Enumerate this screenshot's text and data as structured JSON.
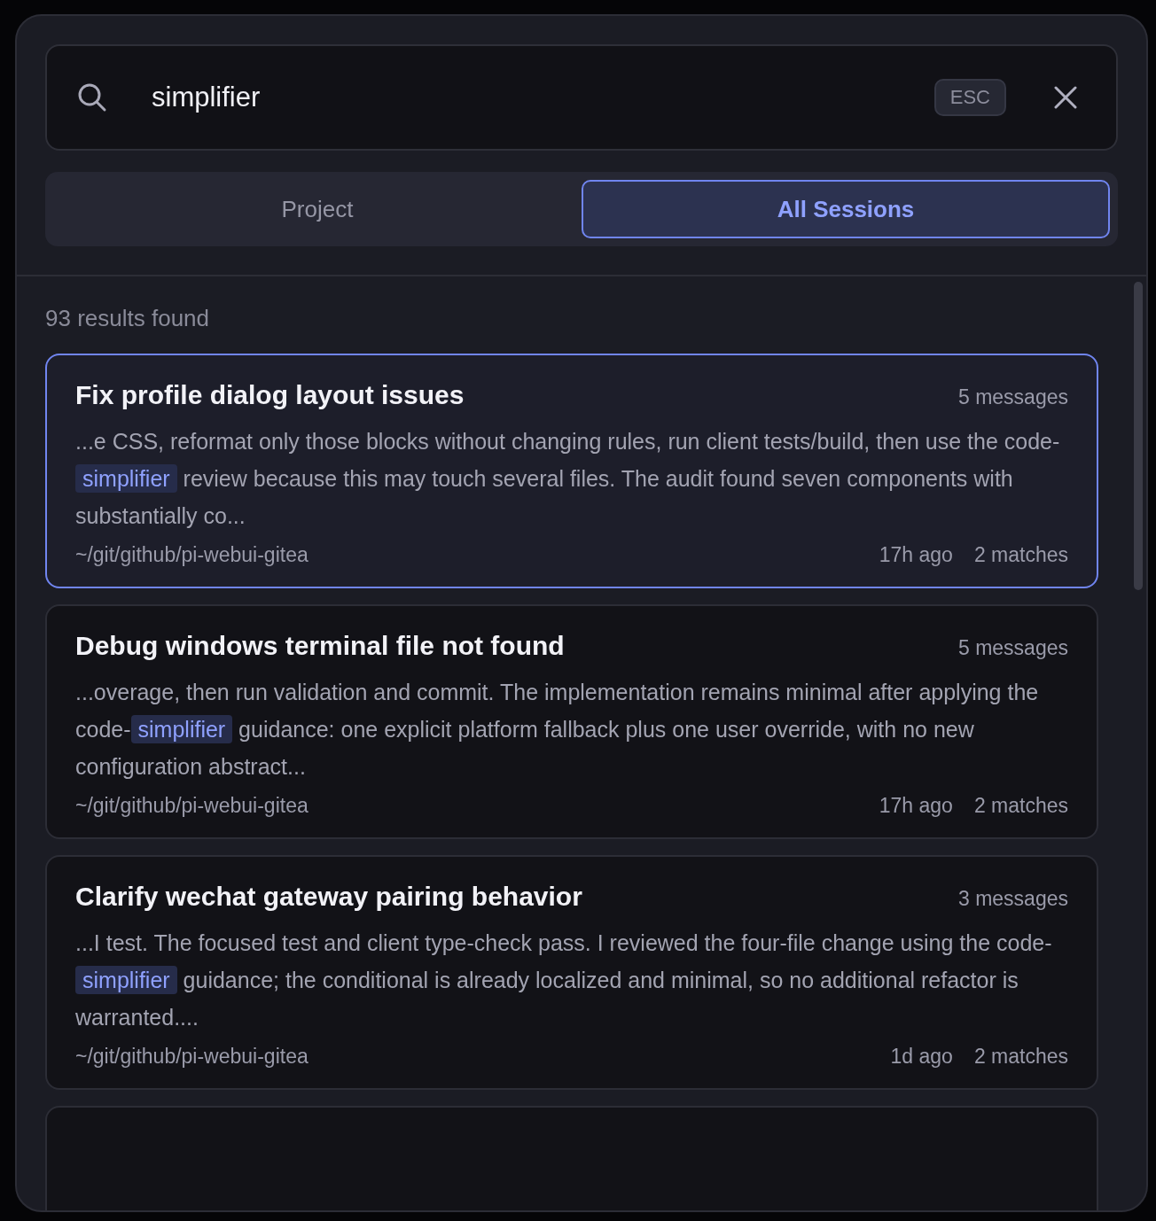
{
  "search": {
    "value": "simplifier",
    "shortcut": "ESC"
  },
  "tabs": [
    {
      "label": "Project",
      "selected": false
    },
    {
      "label": "All Sessions",
      "selected": true
    }
  ],
  "results_count": "93 results found",
  "results": [
    {
      "title": "Fix profile dialog layout issues",
      "messages": "5 messages",
      "snippet_before": "...e CSS, reformat only those blocks without changing rules, run client tests/build, then use the code-",
      "match": "simplifier",
      "snippet_after": "review because this may touch several files. The audit found seven components with substantially co...",
      "path": "~/git/github/pi-webui-gitea",
      "time": "17h ago",
      "matches": "2 matches",
      "selected": true
    },
    {
      "title": "Debug windows terminal file not found",
      "messages": "5 messages",
      "snippet_before": "...overage, then run validation and commit. The implementation remains minimal after applying the code-",
      "match": "simplifier",
      "snippet_after": "guidance: one explicit platform fallback plus one user override, with no new configuration abstract...",
      "path": "~/git/github/pi-webui-gitea",
      "time": "17h ago",
      "matches": "2 matches",
      "selected": false
    },
    {
      "title": "Clarify wechat gateway pairing behavior",
      "messages": "3 messages",
      "snippet_before": "...I test. The focused test and client type-check pass. I reviewed the four-file change using the code-",
      "match": "simplifier",
      "snippet_after": "guidance; the conditional is already localized and minimal, so no additional refactor is warranted....",
      "path": "~/git/github/pi-webui-gitea",
      "time": "1d ago",
      "matches": "2 matches",
      "selected": false
    }
  ]
}
